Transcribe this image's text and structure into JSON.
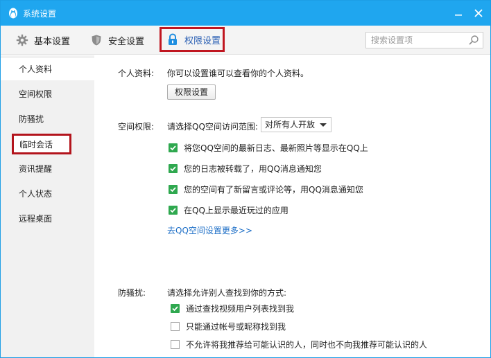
{
  "window": {
    "title": "系统设置"
  },
  "toolbar": {
    "tabs": [
      {
        "label": "基本设置",
        "icon": "gear-icon"
      },
      {
        "label": "安全设置",
        "icon": "shield-icon"
      },
      {
        "label": "权限设置",
        "icon": "lock-icon",
        "selected": true
      }
    ],
    "search_placeholder": "搜索设置项"
  },
  "sidebar": {
    "items": [
      {
        "label": "个人资料",
        "active": true
      },
      {
        "label": "空间权限"
      },
      {
        "label": "防骚扰"
      },
      {
        "label": "临时会话",
        "highlighted": true
      },
      {
        "label": "资讯提醒"
      },
      {
        "label": "个人状态"
      },
      {
        "label": "远程桌面"
      }
    ]
  },
  "profile": {
    "label": "个人资料:",
    "desc": "你可以设置谁可以查看你的个人资料。",
    "button": "权限设置"
  },
  "space": {
    "label": "空间权限:",
    "prompt": "请选择QQ空间访问范围:",
    "select_value": "对所有人开放",
    "options": [
      {
        "text": "将您QQ空间的最新日志、最新照片等显示在QQ上",
        "checked": true
      },
      {
        "text": "您的日志被转载了，用QQ消息通知您",
        "checked": true
      },
      {
        "text": "您的空间有了新留言或评论等，用QQ消息通知您",
        "checked": true
      },
      {
        "text": "在QQ上显示最近玩过的应用",
        "checked": true
      }
    ],
    "link": "去QQ空间设置更多>>"
  },
  "antiharass": {
    "label": "防骚扰:",
    "prompt": "请选择允许别人查找到你的方式:",
    "options": [
      {
        "text": "通过查找视频用户列表找到我",
        "checked": true
      },
      {
        "text": "只能通过帐号或昵称找到我",
        "checked": false
      },
      {
        "text": "不允许将我推荐给可能认识的人，同时也不向我推荐可能认识的人",
        "checked": false
      }
    ]
  },
  "colors": {
    "titlebar": "#1fa6ef",
    "highlight_border": "#c01620",
    "checkbox_checked": "#2fa84f",
    "link": "#1e6fc7"
  }
}
